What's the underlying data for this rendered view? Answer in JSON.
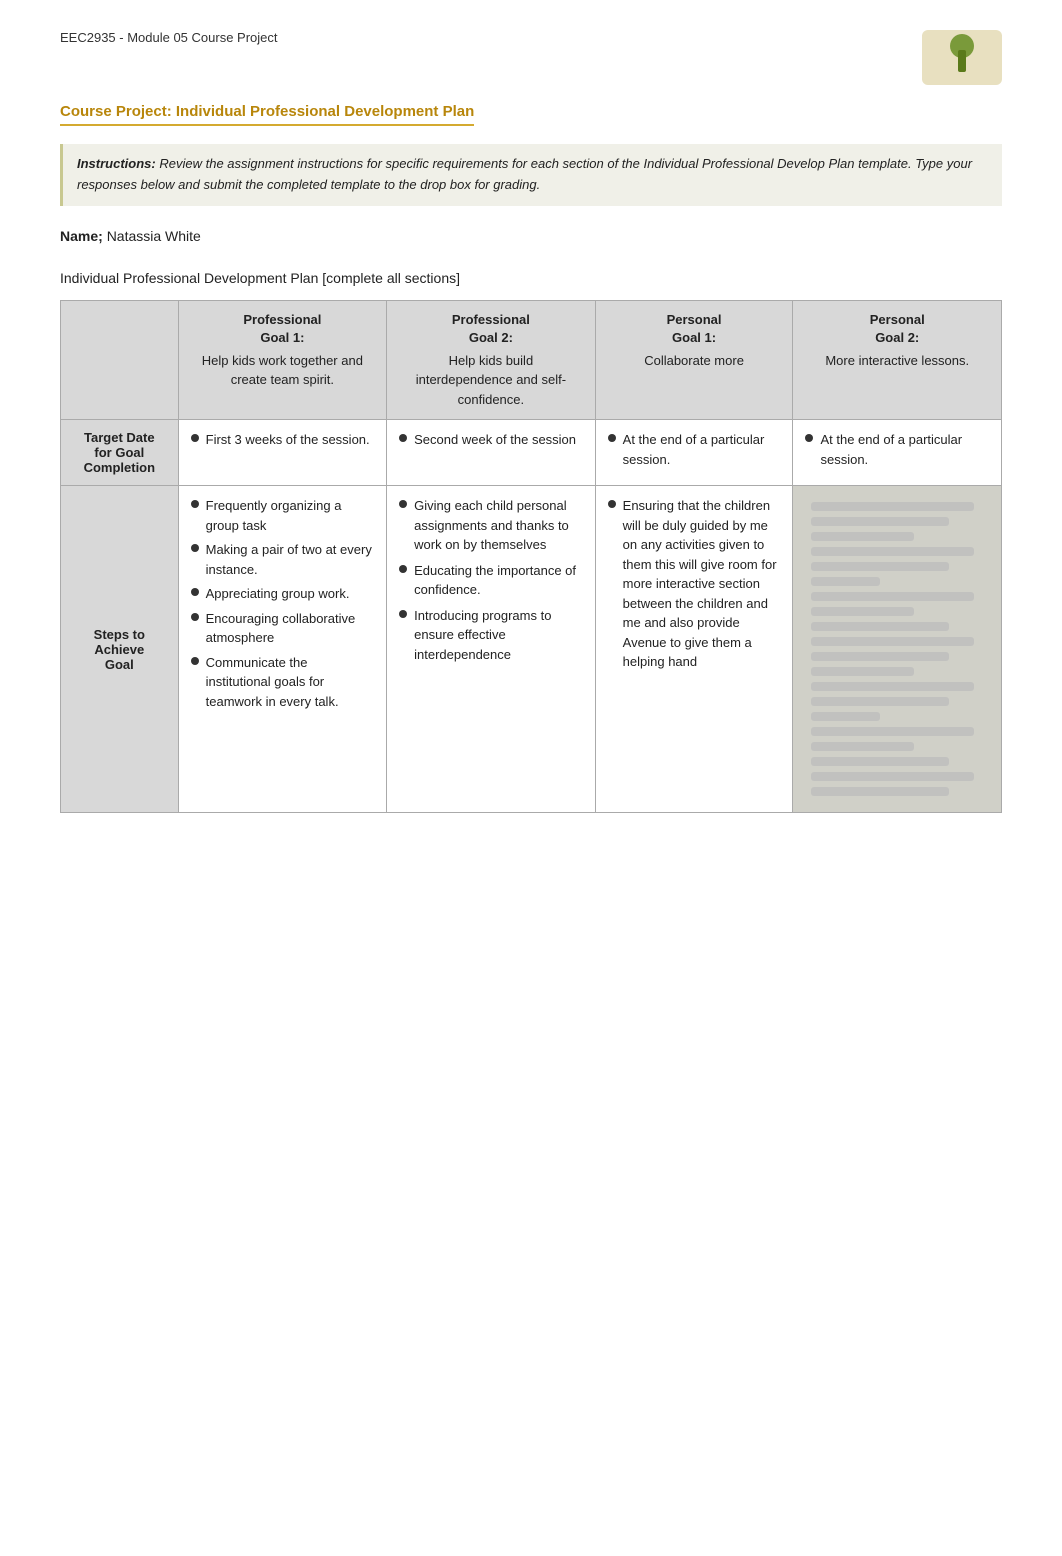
{
  "header": {
    "doc_title": "EEC2935 - Module 05 Course Project",
    "logo_alt": "Logo"
  },
  "course_title": "Course Project: Individual Professional Development Plan",
  "instructions": {
    "label": "Instructions:",
    "text": "Review the assignment instructions for specific requirements for each section of the Individual Professional Develop Plan template.  Type your responses below and submit the completed template to the drop box for grading."
  },
  "name_label": "Name;",
  "name_value": "Natassia White",
  "plan_title": "Individual Professional Development Plan",
  "plan_subtitle": "[complete all sections]",
  "table": {
    "columns": [
      {
        "label": "",
        "sub": ""
      },
      {
        "label": "Professional Goal 1:",
        "sub": "Help kids work together and create team spirit."
      },
      {
        "label": "Professional Goal 2:",
        "sub": "Help kids build interdependence and self-confidence."
      },
      {
        "label": "Personal Goal 1:",
        "sub": "Collaborate more"
      },
      {
        "label": "Personal Goal 2:",
        "sub": "More interactive lessons."
      }
    ],
    "rows": [
      {
        "row_label": "Target Date for Goal Completion",
        "cells": [
          {
            "bullet": "First 3 weeks of the session."
          },
          {
            "bullet": "Second week of the session"
          },
          {
            "bullet": "At the end of a particular session."
          },
          {
            "bullet": "At the end of a particular session.",
            "blurred": false
          }
        ]
      },
      {
        "row_label": "Steps to Achieve Goal",
        "cells": [
          {
            "items": [
              "Frequently organizing a group task",
              "Making a pair of two at every instance.",
              "Appreciating group work.",
              "Encouraging collaborative atmosphere",
              "Communicate the institutional goals for teamwork in every talk."
            ]
          },
          {
            "items": [
              "Giving each child personal assignments and thanks to work on by themselves",
              "Educating the importance of confidence.",
              "Introducing programs to ensure effective interdependence"
            ]
          },
          {
            "items": [
              "Ensuring that the children will be duly guided by me on any activities given to them this will give room for more interactive section between the children and me and also provide Avenue to give them a helping hand"
            ]
          },
          {
            "blurred": true,
            "blur_lines": [
              "long",
              "medium",
              "short",
              "long",
              "medium",
              "vshort",
              "long",
              "short",
              "medium",
              "long",
              "medium",
              "short",
              "long",
              "medium",
              "vshort",
              "long",
              "short",
              "medium",
              "long",
              "medium"
            ]
          }
        ]
      }
    ]
  }
}
